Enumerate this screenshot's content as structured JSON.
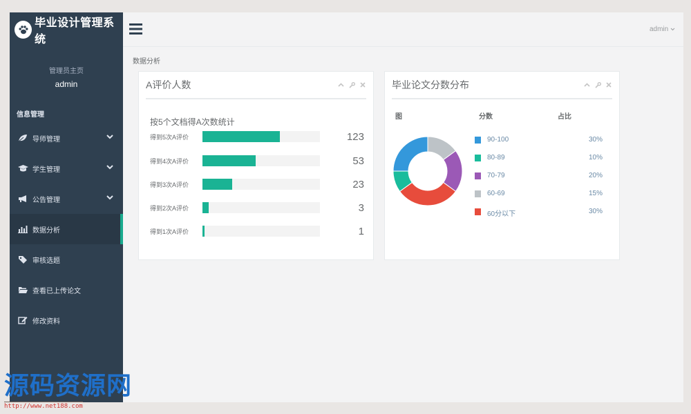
{
  "app": {
    "title": "毕业设计管理系统"
  },
  "profile": {
    "role": "管理员主页",
    "username": "admin"
  },
  "sidebar": {
    "header": "信息管理",
    "items": [
      {
        "label": "导师管理",
        "icon": "leaf-icon",
        "has_children": true
      },
      {
        "label": "学生管理",
        "icon": "graduation-cap-icon",
        "has_children": true
      },
      {
        "label": "公告管理",
        "icon": "megaphone-icon",
        "has_children": true
      },
      {
        "label": "数据分析",
        "icon": "bar-chart-icon",
        "has_children": false,
        "active": true
      },
      {
        "label": "审核选题",
        "icon": "tag-icon",
        "has_children": false
      },
      {
        "label": "查看已上传论文",
        "icon": "folder-open-icon",
        "has_children": false
      },
      {
        "label": "修改资料",
        "icon": "edit-icon",
        "has_children": false
      }
    ]
  },
  "topbar": {
    "user_label": "admin"
  },
  "breadcrumb": "数据分析",
  "panel_a": {
    "title": "A评价人数",
    "subtitle": "按5个文档得A次数统计",
    "rows": [
      {
        "label": "得到5次A评价",
        "value": "123",
        "fill_percent": 66
      },
      {
        "label": "得到4次A评价",
        "value": "53",
        "fill_percent": 45
      },
      {
        "label": "得到3次A评价",
        "value": "23",
        "fill_percent": 25
      },
      {
        "label": "得到2次A评价",
        "value": "3",
        "fill_percent": 5
      },
      {
        "label": "得到1次A评价",
        "value": "1",
        "fill_percent": 2
      }
    ]
  },
  "panel_b": {
    "title": "毕业论文分数分布",
    "headers": {
      "chart": "图",
      "score": "分数",
      "ratio": "占比"
    },
    "chart_data": {
      "type": "pie",
      "categories": [
        "90-100",
        "80-89",
        "70-79",
        "60-69",
        "60分以下"
      ],
      "values": [
        30,
        10,
        20,
        15,
        30
      ],
      "labels_percent": [
        "30%",
        "10%",
        "20%",
        "15%",
        "30%"
      ],
      "colors": [
        "#3498db",
        "#1abc9c",
        "#9b59b6",
        "#bdc3c7",
        "#e74c3c"
      ],
      "donut": true
    },
    "slice_order": [
      {
        "index": 3,
        "percent": 15
      },
      {
        "index": 2,
        "percent": 20
      },
      {
        "index": 4,
        "percent": 30
      },
      {
        "index": 1,
        "percent": 10
      },
      {
        "index": 0,
        "percent": 25
      }
    ]
  },
  "watermark": {
    "text": "源码资源网",
    "url": "http://www.net188.com"
  }
}
